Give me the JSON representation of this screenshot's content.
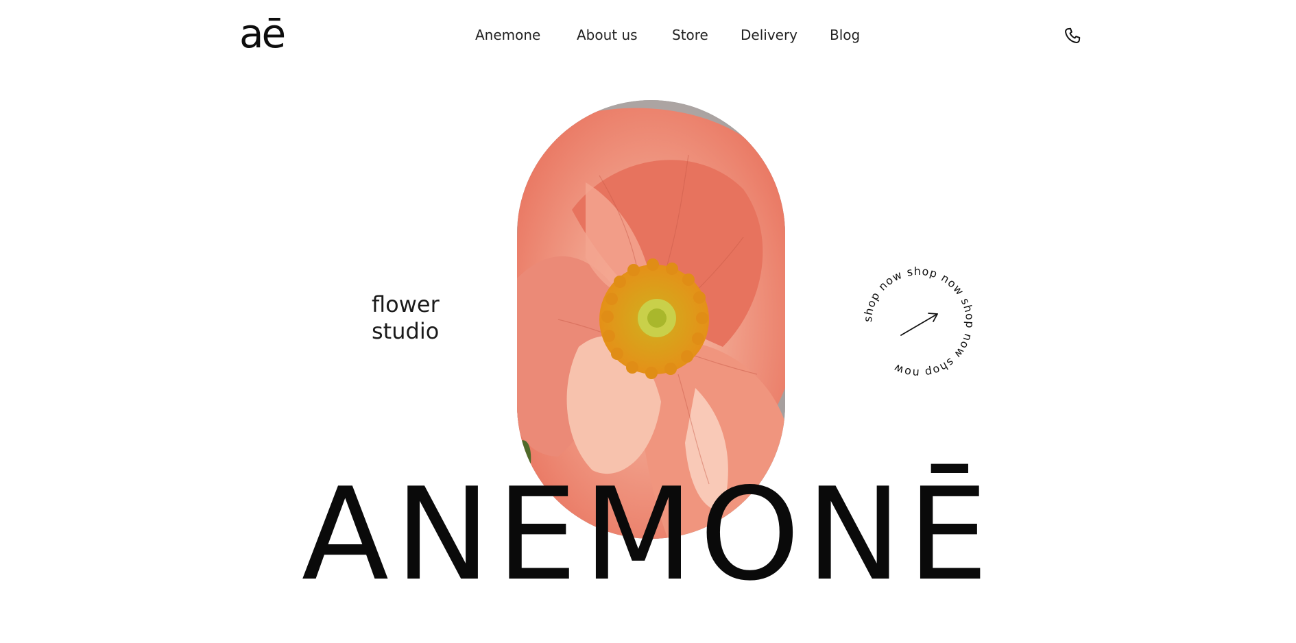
{
  "header": {
    "logo": "aē",
    "nav": [
      "Anemone",
      "About us",
      "Store",
      "Delivery",
      "Blog"
    ],
    "phone_icon": "phone-icon"
  },
  "hero": {
    "tagline_line1": "flower",
    "tagline_line2": "studio",
    "wordmark": "ANEMONĒ",
    "image": "anemone-flower-photo",
    "shop_badge": "shop now shop now shop now shop now ",
    "shop_icon": "arrow-up-right-icon"
  },
  "colors": {
    "text": "#111111",
    "background": "#ffffff",
    "petal": "#ec7e6a",
    "pollen": "#e69a17",
    "backdrop": "#a3a0a0"
  }
}
